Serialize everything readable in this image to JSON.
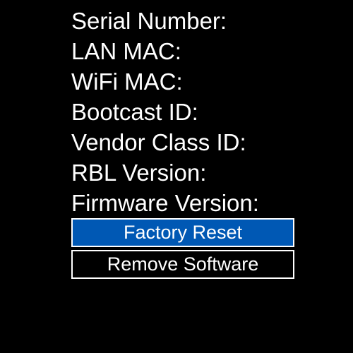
{
  "info": {
    "serial_number": "Serial Number:",
    "lan_mac": "LAN MAC:",
    "wifi_mac": "WiFi MAC:",
    "bootcast_id": "Bootcast ID:",
    "vendor_class_id": "Vendor Class ID:",
    "rbl_version": "RBL Version:",
    "firmware_version": "Firmware Version:"
  },
  "menu": {
    "factory_reset": "Factory Reset",
    "remove_software": "Remove Software",
    "selected": "factory_reset"
  },
  "colors": {
    "background": "#000000",
    "text": "#ffffff",
    "selected_fill": "#0058b4",
    "border": "#ffffff"
  }
}
